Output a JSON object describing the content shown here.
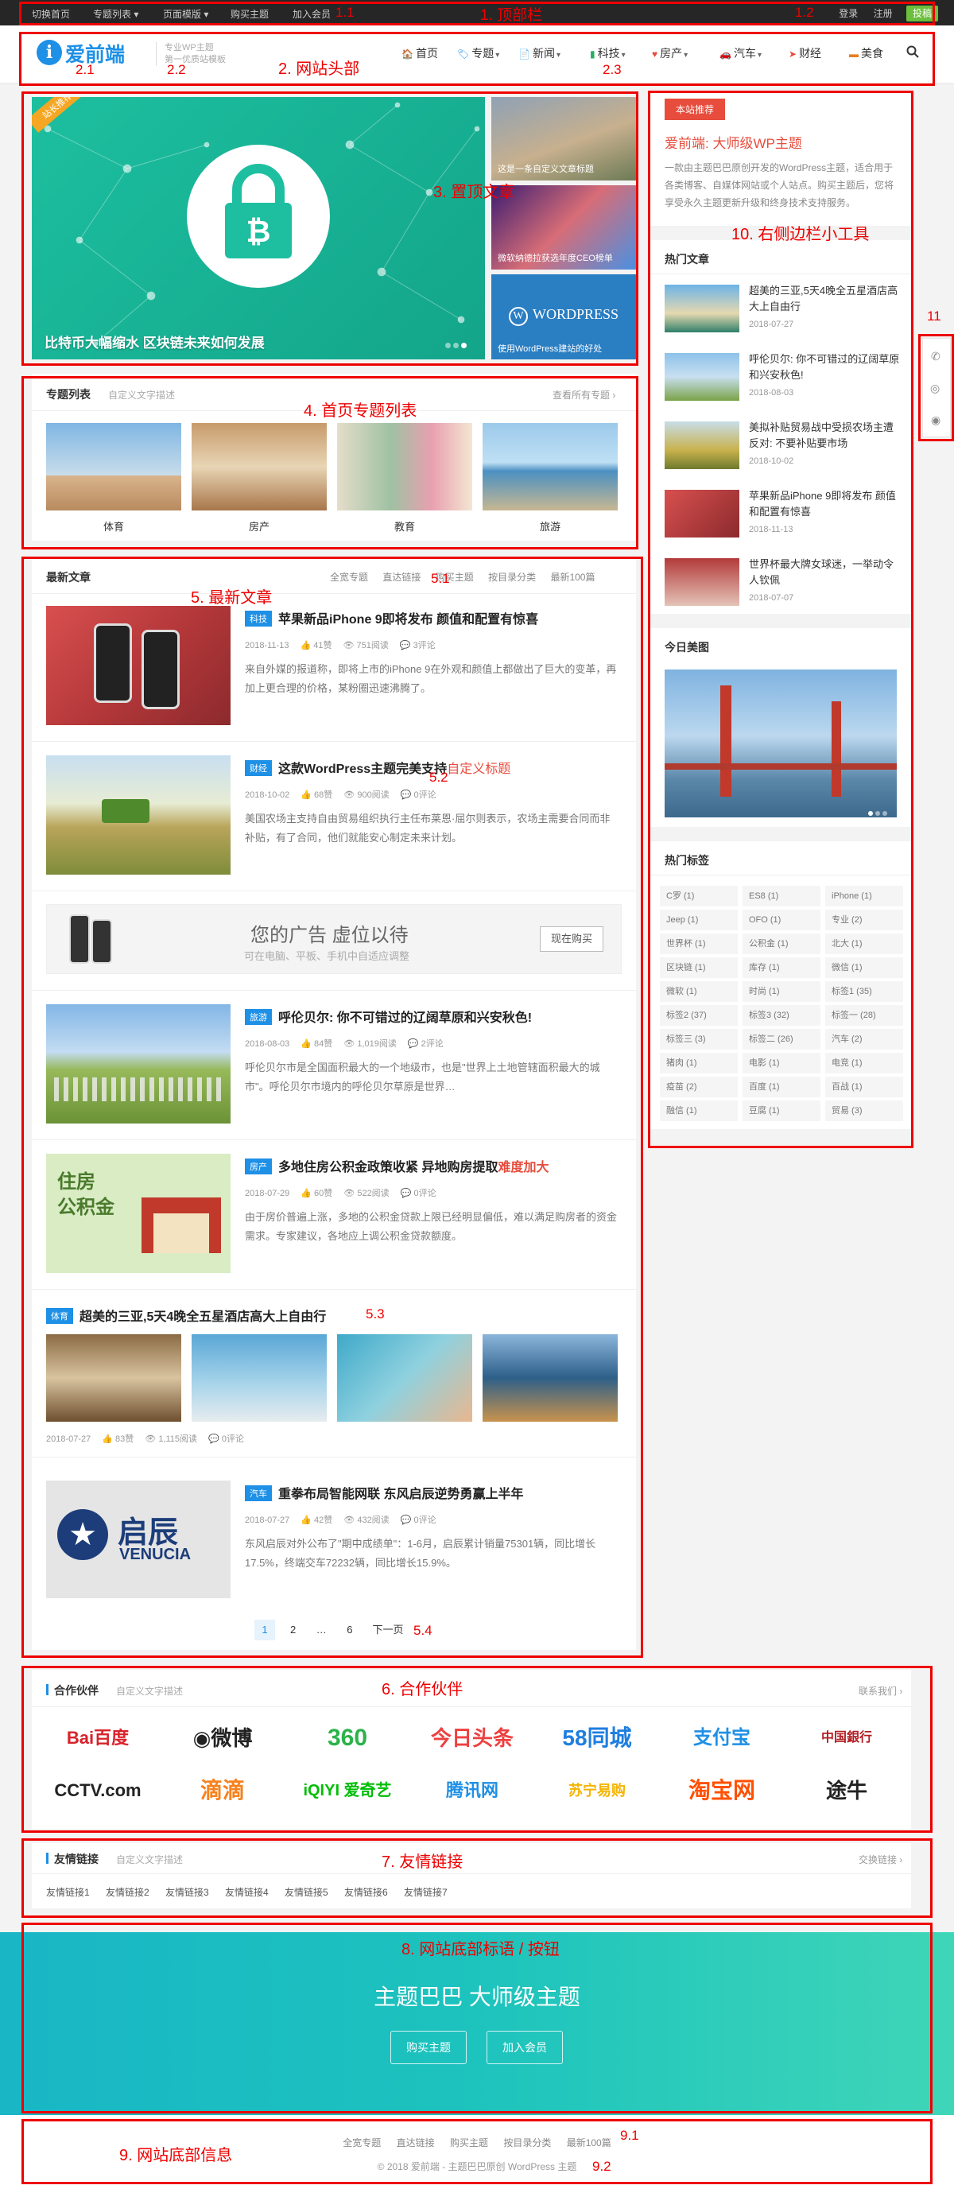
{
  "topbar": {
    "links": [
      "切换首页",
      "专题列表 ▾",
      "页面模版 ▾",
      "购买主题",
      "加入会员"
    ],
    "login": "登录",
    "register": "注册",
    "submit": "投稿"
  },
  "header": {
    "logo_char": "i",
    "logo_text": "爱前端",
    "tagline_1": "专业WP主题",
    "tagline_2": "第一优质站模板",
    "nav": [
      {
        "icon": "home-icon",
        "glyph": "🏠",
        "color": "#e74c3c",
        "label": "首页",
        "arrow": ""
      },
      {
        "icon": "tag-icon",
        "glyph": "🏷",
        "color": "#1e90e6",
        "label": "专题",
        "arrow": "▾"
      },
      {
        "icon": "file-icon",
        "glyph": "📄",
        "color": "#f39c12",
        "label": "新闻",
        "arrow": "▾"
      },
      {
        "icon": "bookmark-icon",
        "glyph": "▮",
        "color": "#27ae60",
        "label": "科技",
        "arrow": "▾"
      },
      {
        "icon": "heart-icon",
        "glyph": "♥",
        "color": "#e74c3c",
        "label": "房产",
        "arrow": "▾"
      },
      {
        "icon": "car-icon",
        "glyph": "🚗",
        "color": "#e74c3c",
        "label": "汽车",
        "arrow": "▾"
      },
      {
        "icon": "send-icon",
        "glyph": "➤",
        "color": "#e74c3c",
        "label": "财经",
        "arrow": ""
      },
      {
        "icon": "food-icon",
        "glyph": "▬",
        "color": "#e67e22",
        "label": "美食",
        "arrow": ""
      }
    ],
    "search_icon": "search-icon"
  },
  "slider": {
    "badge": "站长推荐",
    "caption": "比特币大幅缩水 区块链未来如何发展",
    "side": [
      "这是一条自定义文章标题",
      "微软纳德拉获选年度CEO榜单",
      "使用WordPress建站的好处"
    ],
    "wp_logo": "WORDPRESS"
  },
  "topics": {
    "title": "专题列表",
    "sub": "自定义文字描述",
    "more": "查看所有专题 ›",
    "items": [
      "体育",
      "房产",
      "教育",
      "旅游"
    ]
  },
  "latest": {
    "title": "最新文章",
    "links": [
      "全宽专题",
      "直达链接",
      "购买主题",
      "按目录分类",
      "最新100篇"
    ],
    "posts": [
      {
        "tag": "科技",
        "title": "苹果新品iPhone 9即将发布 颜值和配置有惊喜",
        "title_red": "",
        "date": "2018-11-13",
        "likes": "41赞",
        "views": "751阅读",
        "comments": "3评论",
        "excerpt": "来自外媒的报道称，即将上市的iPhone 9在外观和颜值上都做出了巨大的变革，再加上更合理的价格，某粉圈迅速沸腾了。",
        "tagcolor": "#1e90e6"
      },
      {
        "tag": "财经",
        "title": "这款WordPress主题完美支持",
        "title_red": "自定义标题",
        "date": "2018-10-02",
        "likes": "68赞",
        "views": "900阅读",
        "comments": "0评论",
        "excerpt": "美国农场主支持自由贸易组织执行主任布莱恩·屈尔则表示，农场主需要合同而非补贴，有了合同，他们就能安心制定未来计划。",
        "tagcolor": "#1e90e6"
      },
      {
        "tag": "旅游",
        "title": "呼伦贝尔: 你不可错过的辽阔草原和兴安秋色!",
        "title_red": "",
        "date": "2018-08-03",
        "likes": "84赞",
        "views": "1,019阅读",
        "comments": "2评论",
        "excerpt": "呼伦贝尔市是全国面积最大的一个地级市，也是\"世界上土地管辖面积最大的城市\"。呼伦贝尔市境内的呼伦贝尔草原是世界…",
        "tagcolor": "#1e90e6"
      },
      {
        "tag": "房产",
        "title": "多地住房公积金政策收紧 异地购房提取",
        "title_red": "难度加大",
        "date": "2018-07-29",
        "likes": "60赞",
        "views": "522阅读",
        "comments": "0评论",
        "excerpt": "由于房价普遍上涨，多地的公积金贷款上限已经明显偏低，难以满足购房者的资金需求。专家建议，各地应上调公积金贷款额度。",
        "tagcolor": "#1e90e6"
      }
    ],
    "ad": {
      "main": "您的广告 虚位以待",
      "sub": "可在电脑、平板、手机中自适应调整",
      "button": "现在购买"
    },
    "gallery_post": {
      "tag": "体育",
      "title": "超美的三亚,5天4晚全五星酒店高大上自由行",
      "date": "2018-07-27",
      "likes": "83赞",
      "views": "1,115阅读",
      "comments": "0评论"
    },
    "last_post": {
      "tag": "汽车",
      "title": "重拳布局智能网联 东风启辰逆势勇赢上半年",
      "date": "2018-07-27",
      "likes": "42赞",
      "views": "432阅读",
      "comments": "0评论",
      "excerpt": "东风启辰对外公布了\"期中成绩单\"：1-6月，启辰累计销量75301辆，同比增长17.5%，终端交车72232辆，同比增长15.9%。",
      "logo": "启辰",
      "logo_en": "VENUCIA"
    },
    "pagination": [
      "1",
      "2",
      "…",
      "6",
      "下一页"
    ]
  },
  "sidebar": {
    "rec_badge": "本站推荐",
    "rec_title": "爱前端: 大师级WP主题",
    "rec_text": "一款由主题巴巴原创开发的WordPress主题，适合用于各类博客、自媒体网站或个人站点。购买主题后，您将享受永久主题更新升级和终身技术支持服务。",
    "hot_title": "热门文章",
    "hot": [
      {
        "title": "超美的三亚,5天4晚全五星酒店高大上自由行",
        "date": "2018-07-27"
      },
      {
        "title": "呼伦贝尔: 你不可错过的辽阔草原和兴安秋色!",
        "date": "2018-08-03"
      },
      {
        "title": "美拟补贴贸易战中受损农场主遭反对: 不要补贴要市场",
        "date": "2018-10-02"
      },
      {
        "title": "苹果新品iPhone 9即将发布 颜值和配置有惊喜",
        "date": "2018-11-13"
      },
      {
        "title": "世界杯最大牌女球迷，一举动令人钦佩",
        "date": "2018-07-07"
      }
    ],
    "pic_title": "今日美图",
    "tags_title": "热门标签",
    "tags": [
      "C罗 (1)",
      "ES8 (1)",
      "iPhone (1)",
      "Jeep (1)",
      "OFO (1)",
      "专业 (2)",
      "世界杯 (1)",
      "公积金 (1)",
      "北大 (1)",
      "区块链 (1)",
      "库存 (1)",
      "微信 (1)",
      "微软 (1)",
      "时尚 (1)",
      "标签1 (35)",
      "标签2 (37)",
      "标签3 (32)",
      "标签一 (28)",
      "标签三 (3)",
      "标签二 (26)",
      "汽车 (2)",
      "猪肉 (1)",
      "电影 (1)",
      "电竞 (1)",
      "疫苗 (2)",
      "百度 (1)",
      "百战 (1)",
      "融信 (1)",
      "豆腐 (1)",
      "贸易 (3)"
    ]
  },
  "partners": {
    "title": "合作伙伴",
    "sub": "自定义文字描述",
    "more": "联系我们 ›",
    "logos": [
      {
        "name": "Bai百度",
        "color": "#d9222a",
        "size": 22
      },
      {
        "name": "◉微博",
        "color": "#222",
        "size": 26
      },
      {
        "name": "360",
        "color": "#2bb34a",
        "size": 30
      },
      {
        "name": "今日头条",
        "color": "#ed4040",
        "size": 26
      },
      {
        "name": "58同城",
        "color": "#1e7ee0",
        "size": 28
      },
      {
        "name": "支付宝",
        "color": "#1e90e6",
        "size": 24
      },
      {
        "name": "中国銀行",
        "color": "#b21f24",
        "size": 16
      },
      {
        "name": "CCTV.com",
        "color": "#222",
        "size": 22
      },
      {
        "name": "滴滴",
        "color": "#f6821f",
        "size": 28
      },
      {
        "name": "iQIYI 爱奇艺",
        "color": "#00be06",
        "size": 20
      },
      {
        "name": "腾讯网",
        "color": "#1e90e6",
        "size": 22
      },
      {
        "name": "苏宁易购",
        "color": "#f5b400",
        "size": 18
      },
      {
        "name": "淘宝网",
        "color": "#ff5000",
        "size": 28
      },
      {
        "name": "途牛",
        "color": "#222",
        "size": 26
      }
    ]
  },
  "friends": {
    "title": "友情链接",
    "sub": "自定义文字描述",
    "more": "交换链接 ›",
    "links": [
      "友情链接1",
      "友情链接2",
      "友情链接3",
      "友情链接4",
      "友情链接5",
      "友情链接6",
      "友情链接7"
    ]
  },
  "cta": {
    "title": "主题巴巴 大师级主题",
    "btn_buy": "购买主题",
    "btn_join": "加入会员"
  },
  "footer": {
    "links": [
      "全宽专题",
      "直达链接",
      "购买主题",
      "按目录分类",
      "最新100篇"
    ],
    "copyright": "© 2018 爱前端 - 主题巴巴原创 WordPress 主题"
  },
  "float": [
    "phone-icon",
    "wechat-icon",
    "weibo-icon"
  ],
  "annotations": {
    "a1": "1. 顶部栏",
    "a11": "1.1",
    "a12": "1.2",
    "a2": "2. 网站头部",
    "a21": "2.1",
    "a22": "2.2",
    "a23": "2.3",
    "a3": "3. 置顶文章",
    "a4": "4. 首页专题列表",
    "a5": "5. 最新文章",
    "a51": "5.1",
    "a52": "5.2",
    "a53": "5.3",
    "a54": "5.4",
    "a6": "6. 合作伙伴",
    "a7": "7. 友情链接",
    "a8": "8. 网站底部标语 / 按钮",
    "a9": "9. 网站底部信息",
    "a91": "9.1",
    "a92": "9.2",
    "a10": "10. 右侧边栏小工具",
    "a11n": "11"
  }
}
